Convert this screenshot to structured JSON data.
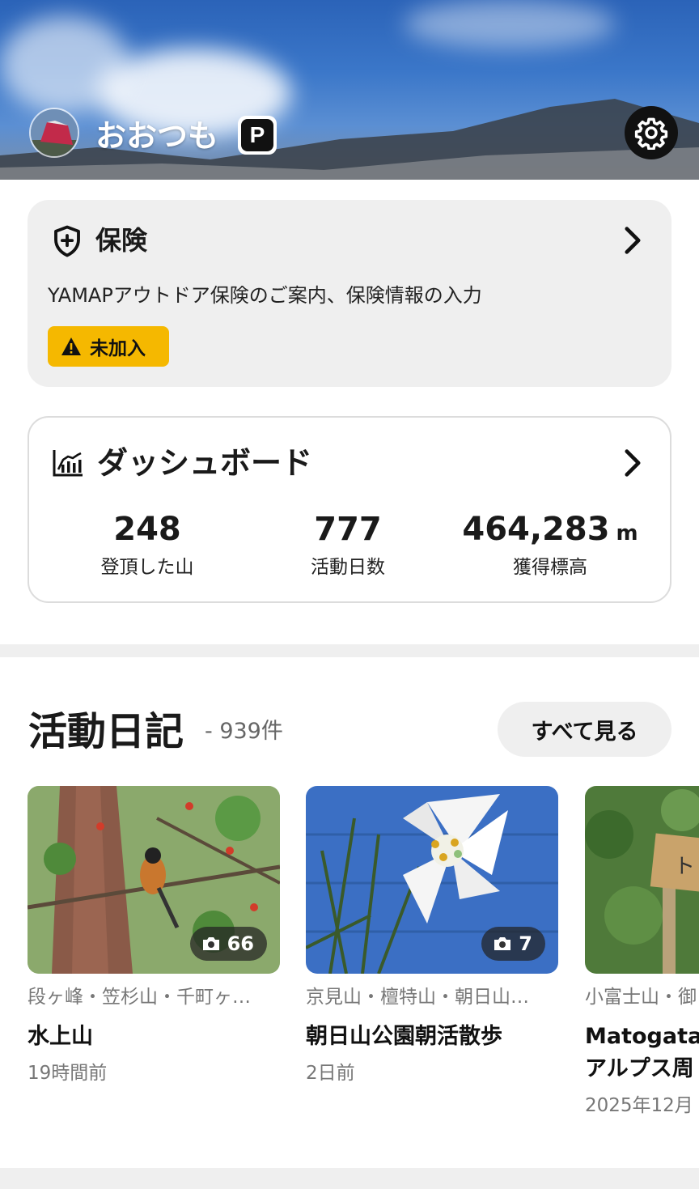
{
  "header": {
    "username": "おおつも",
    "premium_badge": "P",
    "settings_icon": "gear-icon"
  },
  "insurance": {
    "title": "保険",
    "description": "YAMAPアウトドア保険のご案内、保険情報の入力",
    "status": "未加入",
    "status_color": "#f5b800"
  },
  "dashboard": {
    "title": "ダッシュボード",
    "stats": [
      {
        "value": "248",
        "unit": "",
        "label": "登頂した山"
      },
      {
        "value": "777",
        "unit": "",
        "label": "活動日数"
      },
      {
        "value": "464,283",
        "unit": "m",
        "label": "獲得標高"
      }
    ]
  },
  "diaries": {
    "title": "活動日記",
    "count": "- 939件",
    "see_all": "すべて見る",
    "items": [
      {
        "mountains": "段ヶ峰・笠杉山・千町ヶ…",
        "title": "水上山",
        "time": "19時間前",
        "photo_count": "66"
      },
      {
        "mountains": "京見山・檀特山・朝日山…",
        "title": "朝日山公園朝活散歩",
        "time": "2日前",
        "photo_count": "7"
      },
      {
        "mountains": "小富士山・御",
        "title": "Matogata アルプス周",
        "time": "2025年12月"
      }
    ]
  }
}
